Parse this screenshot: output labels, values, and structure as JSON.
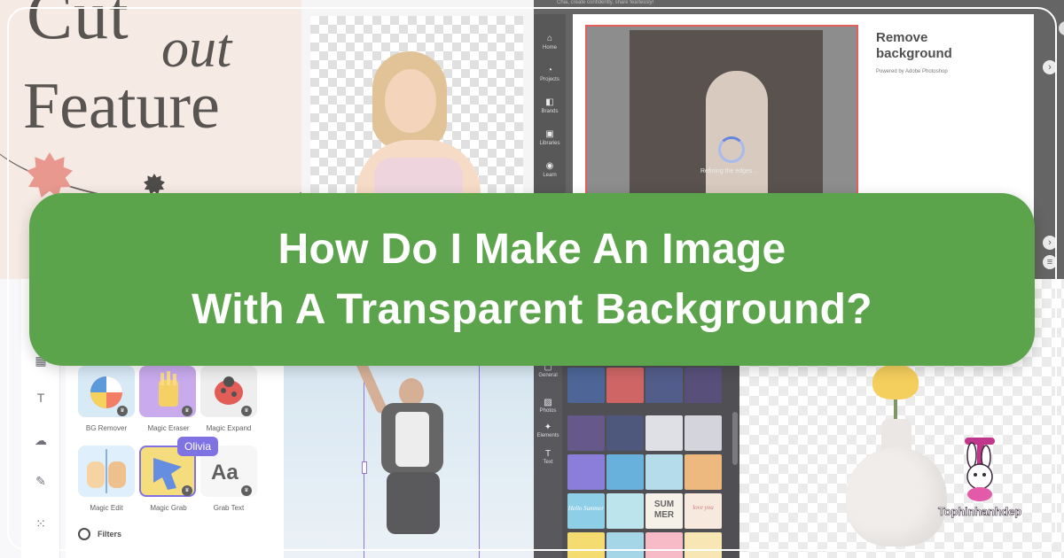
{
  "banner": {
    "line1": "How Do I Make An Image",
    "line2": "With A Transparent Background?"
  },
  "brand": {
    "wordmark": "Tophinhanhdep",
    "banner_color": "#5ba44b",
    "text_color": "#ffffff"
  },
  "poster": {
    "cut": "Cut",
    "out": "out",
    "feature": "Feature"
  },
  "adobe": {
    "top_text": "Chia, create confidently, share fearlessly!",
    "rail_items": [
      "Home",
      "Projects",
      "Brands",
      "Libraries",
      "Learn"
    ],
    "status": "Refining the edges...",
    "panel_title_1": "Remove",
    "panel_title_2": "background",
    "powered_by": "Powered by Adobe Photoshop"
  },
  "canva_tools": {
    "tools": [
      {
        "label": "BG Remover",
        "icon": "beach-ball-icon"
      },
      {
        "label": "Magic Eraser",
        "icon": "hand-fries-icon"
      },
      {
        "label": "Magic Expand",
        "icon": "ladybug-icon"
      },
      {
        "label": "Magic Edit",
        "icon": "hands-icon"
      },
      {
        "label": "Magic Grab",
        "icon": "grab-icon"
      },
      {
        "label": "Grab Text",
        "icon": "text-aa-icon"
      }
    ],
    "collaborator_tag": "Olivia",
    "section_label": "Filters",
    "accent": "#5b4bdb"
  },
  "canva_photos": {
    "rail_items": [
      "General",
      "Photos",
      "Elements",
      "Text"
    ],
    "tile_text": {
      "summer": "SUM MER",
      "love": "love you",
      "hello": "Hello Summer"
    }
  }
}
